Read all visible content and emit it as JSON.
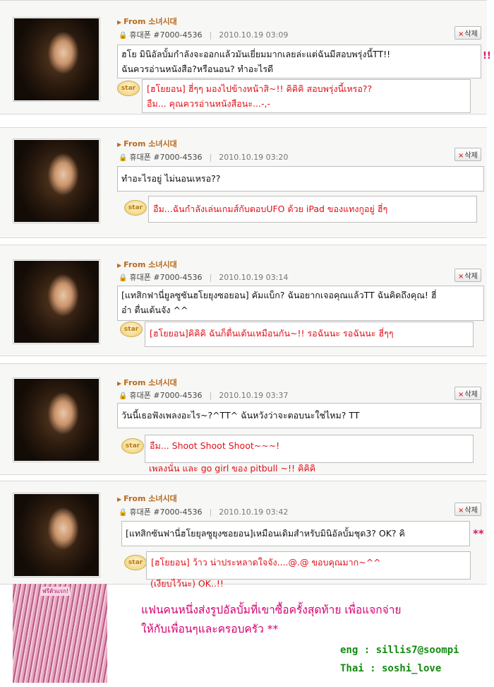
{
  "credits": {
    "eng": "eng : sillis7@soompi",
    "thai": "Thai : soshi_love"
  },
  "common": {
    "from": "From 소녀시대",
    "author": "휴대폰 #7000-4536",
    "delete": "삭제",
    "star": "star"
  },
  "posts": [
    {
      "date": "2010.10.19 03:09",
      "message": [
        "ฮโย มินิอัลบั้มกำลังจะออกแล้วมันเยี่ยมมากเลยล่ะแต่ฉันมีสอบพรุ่งนี้TT!!",
        "ฉันควรอ่านหนังสือ?หรือนอน? ทำอะไรดี"
      ],
      "reply": [
        "[ฮโยยอน] ฮี่ๆๆ มองไปข้างหน้าสิ~!! คิคิคิ สอบพรุ่งนี้เหรอ??",
        "อืม... คุณควรอ่านหนังสือนะ...-,-"
      ]
    },
    {
      "date": "2010.10.19 03:20",
      "message": [
        "ทำอะไรอยู่ ไม่นอนเหรอ??"
      ],
      "reply": [
        "อืม...ฉันกำลังเล่นเกมส์กับตอบUFO ด้วย iPad ของแทงกูอยู่ ฮี่ๆ"
      ]
    },
    {
      "date": "2010.10.19 03:14",
      "message": [
        "[แทสิกฟานี่ยูลซูซันฮโยยุงซอยอน] คัมแบ็ก? ฉันอยากเจอคุณแล้วTT ฉันคิดถึงคุณ! ฮี่",
        "อ๋า ตื่นเต้นจัง ^^"
      ],
      "reply": [
        "[ฮโยยอน]คิคิคิ ฉันก็ตื่นเต้นเหมือนกัน~!! รอฉันนะ รอฉันนะ ฮี่ๆๆ"
      ]
    },
    {
      "date": "2010.10.19 03:37",
      "message": [
        "วันนี้เธอฟังเพลงอะไร~?^TT^ ฉันหวังว่าจะตอบนะใช่ไหม? TT"
      ],
      "reply": [
        "อืม... Shoot Shoot Shoot~~~!",
        "เพลงนั่น และ go girl ของ pitbull ~!! คิคิคิ"
      ]
    },
    {
      "date": "2010.10.19 03:42",
      "message": [
        "[แทสิกซันฟานี่ฮโยยุลซูยุงซอยอน]เหมือนเดิมสำหรับมินิอัลบั้มชุด3? OK? คิ"
      ],
      "reply": [
        "[ฮโยยอน] ว้าว น่าประหลาดใจจัง....@.@ ขอบคุณมาก~^^",
        "(เงียบไว้นะ) OK..!!"
      ]
    }
  ],
  "marks": {
    "m1": "!!",
    "m2": "**"
  },
  "caption": [
    "แฟนคนหนึ่งส่งรูปอัลบั้มที่เขาซื้อครั้งสุดท้าย เพื่อแจกจ่าย",
    "ให้กับเพื่อนๆและครอบครัว **"
  ],
  "gift_label": "ฟรีตัวแรก!"
}
